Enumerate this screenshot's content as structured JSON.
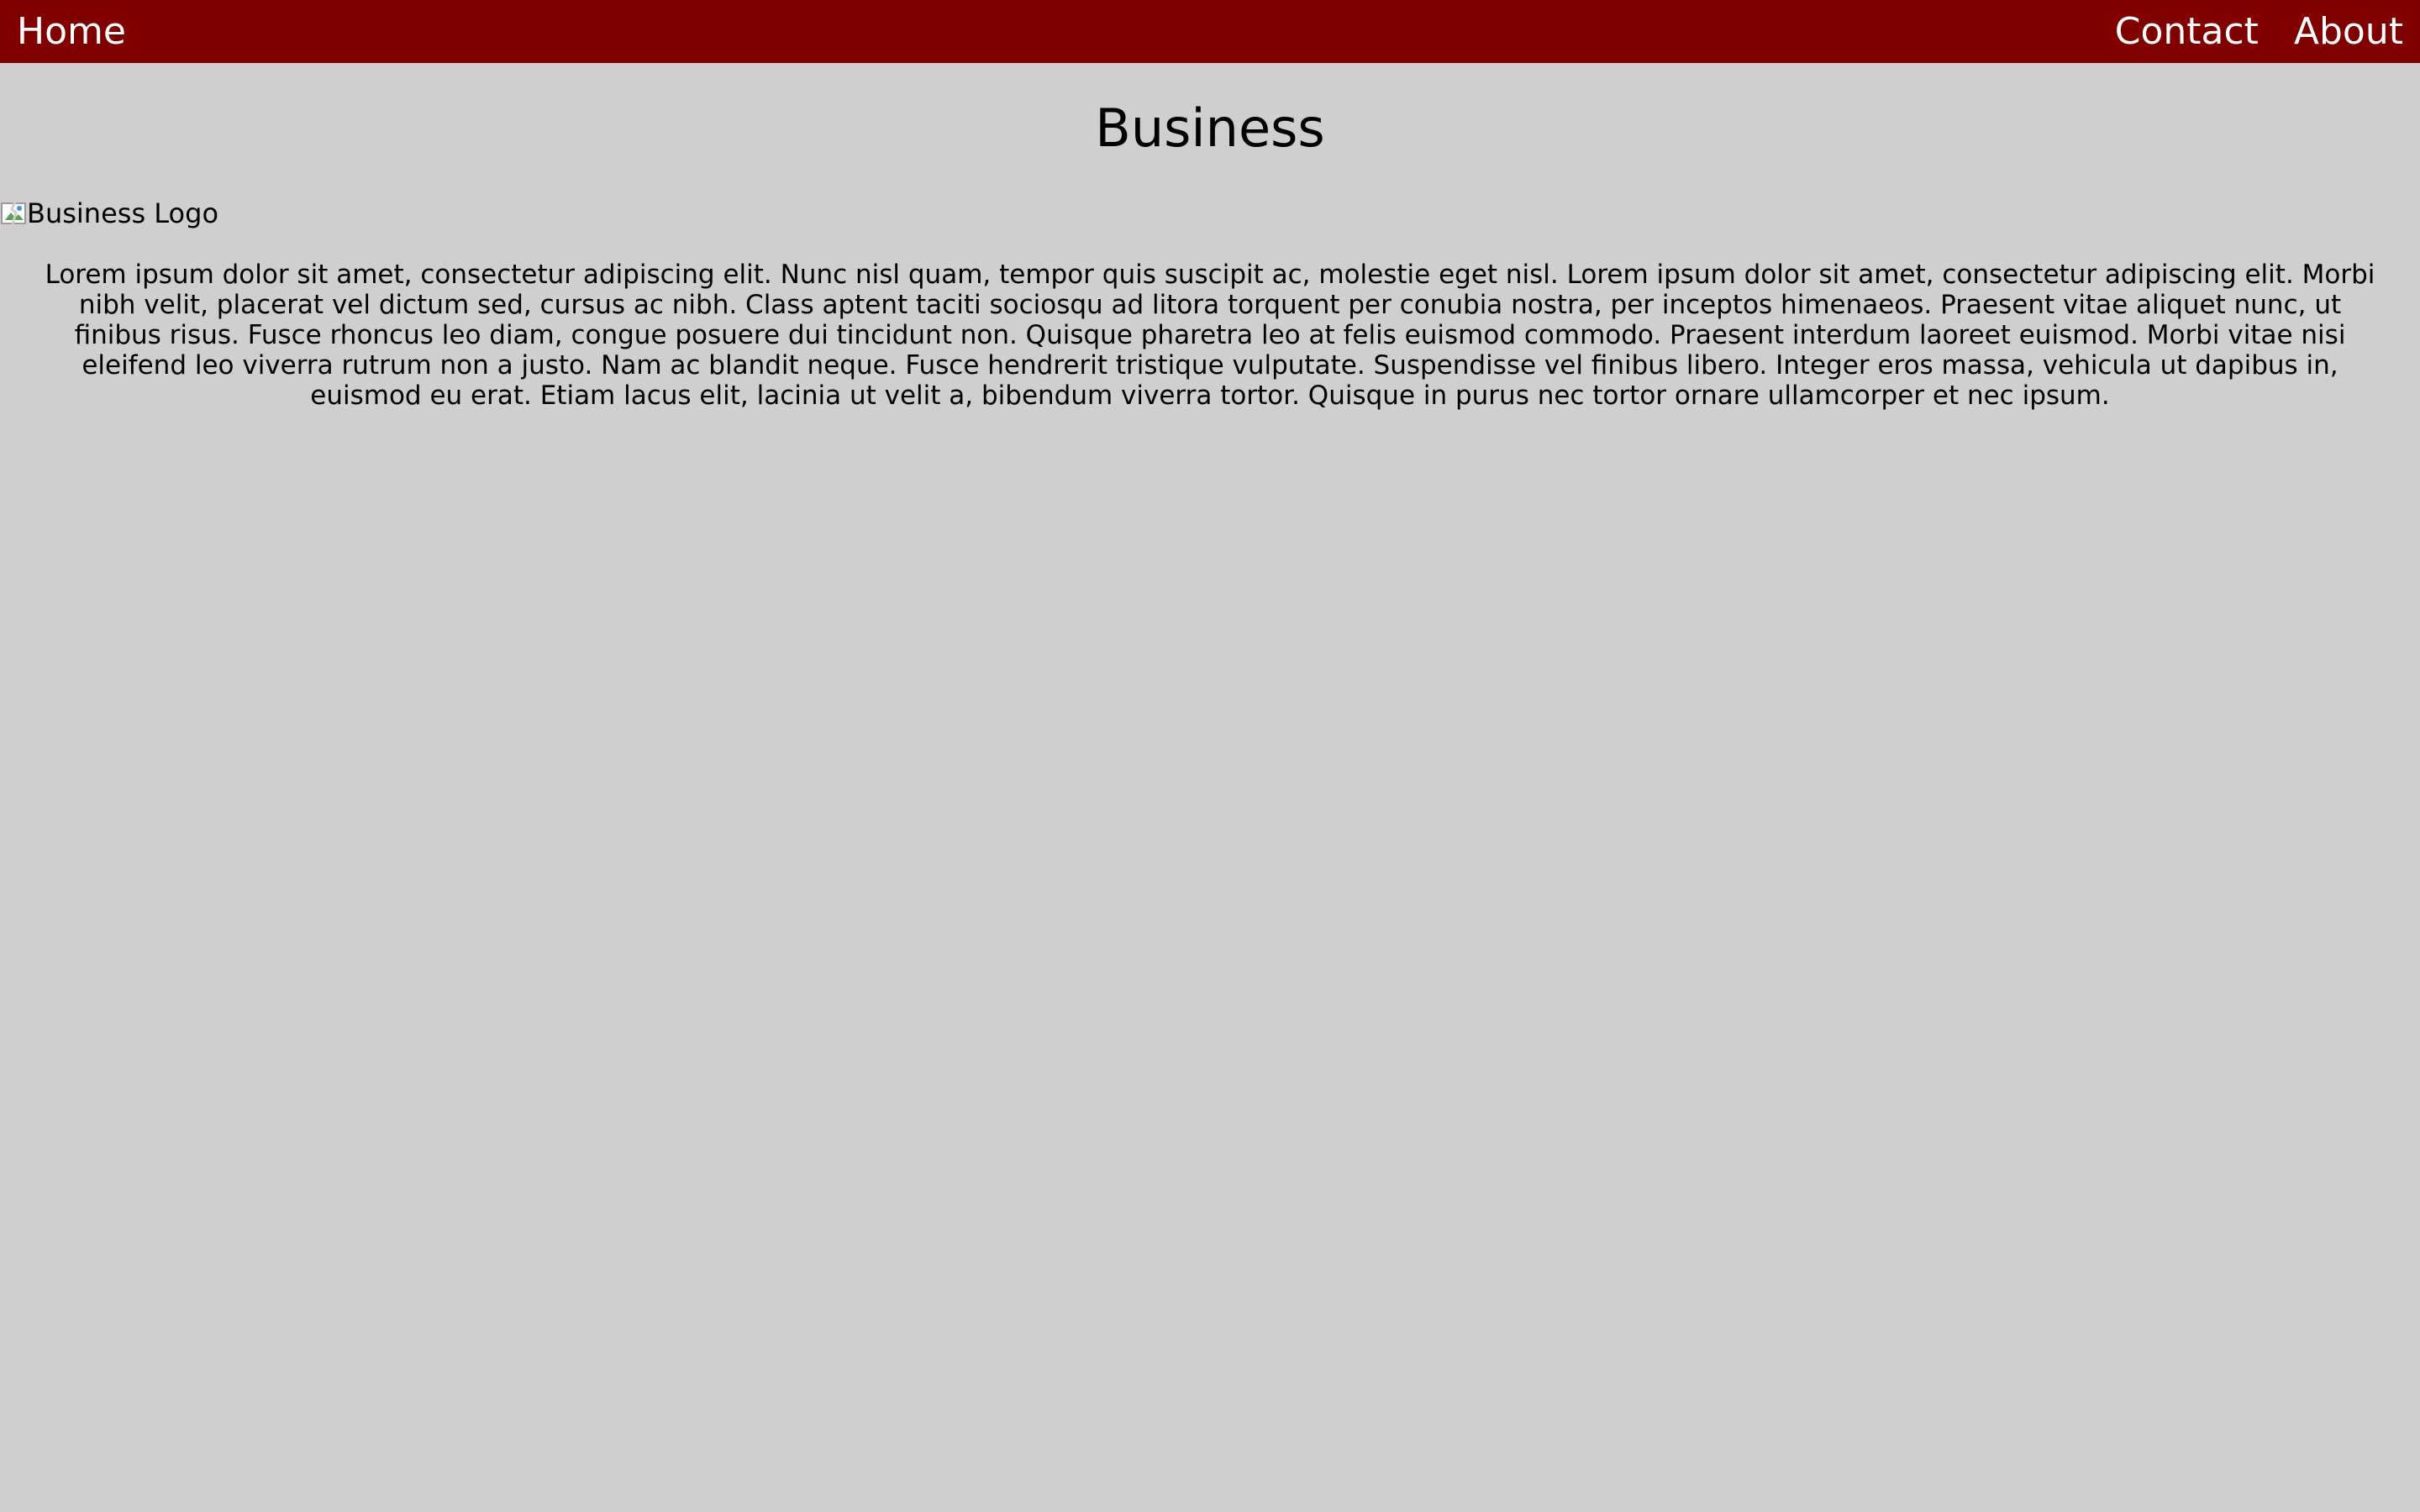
{
  "nav": {
    "home": "Home",
    "contact": "Contact",
    "about": "About"
  },
  "page": {
    "title": "Business",
    "logo_alt": "Business Logo",
    "intro": "Lorem ipsum dolor sit amet, consectetur adipiscing elit. Nunc nisl quam, tempor quis suscipit ac, molestie eget nisl. Lorem ipsum dolor sit amet, consectetur adipiscing elit. Morbi nibh velit, placerat vel dictum sed, cursus ac nibh. Class aptent taciti sociosqu ad litora torquent per conubia nostra, per inceptos himenaeos. Praesent vitae aliquet nunc, ut finibus risus. Fusce rhoncus leo diam, congue posuere dui tincidunt non. Quisque pharetra leo at felis euismod commodo. Praesent interdum laoreet euismod. Morbi vitae nisi eleifend leo viverra rutrum non a justo. Nam ac blandit neque. Fusce hendrerit tristique vulputate. Suspendisse vel finibus libero. Integer eros massa, vehicula ut dapibus in, euismod eu erat. Etiam lacus elit, lacinia ut velit a, bibendum viverra tortor. Quisque in purus nec tortor ornare ullamcorper et nec ipsum."
  },
  "colors": {
    "nav_background": "#800000",
    "nav_text": "#ffffff",
    "page_background": "#cfcfcf",
    "text": "#000000"
  },
  "icons": {
    "logo_image": "broken-image-icon"
  }
}
